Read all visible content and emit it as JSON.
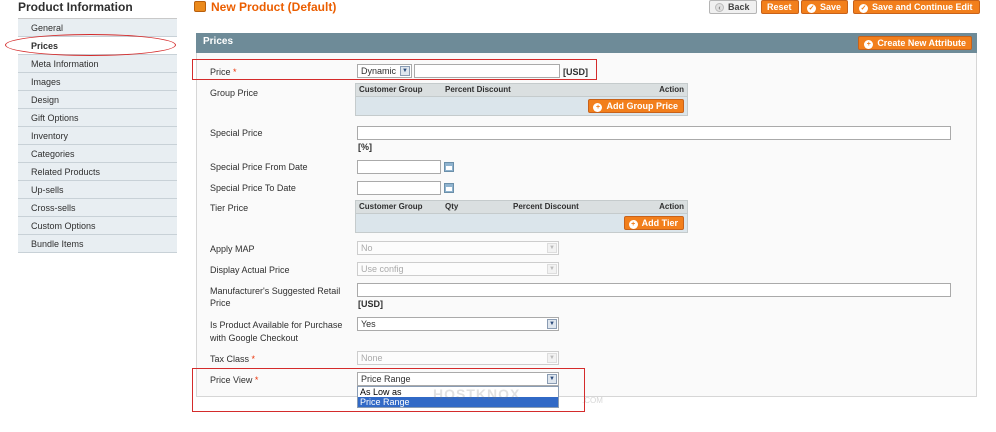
{
  "sidebar": {
    "title": "Product Information",
    "items": [
      "General",
      "Prices",
      "Meta Information",
      "Images",
      "Design",
      "Gift Options",
      "Inventory",
      "Categories",
      "Related Products",
      "Up-sells",
      "Cross-sells",
      "Custom Options",
      "Bundle Items"
    ],
    "active": "Prices"
  },
  "header": {
    "title": "New Product (Default)",
    "back_label": "Back",
    "reset_label": "Reset",
    "save_label": "Save",
    "save_continue_label": "Save and Continue Edit"
  },
  "section": {
    "title": "Prices",
    "create_attribute_label": "Create New Attribute"
  },
  "form": {
    "price": {
      "label": "Price",
      "required": "*",
      "type_value": "Dynamic",
      "value": "",
      "currency": "[USD]"
    },
    "group_price": {
      "label": "Group Price",
      "columns": [
        "Customer Group",
        "Percent Discount",
        "Action"
      ],
      "add_label": "Add Group Price"
    },
    "special_price": {
      "label": "Special Price",
      "value": "",
      "unit": "[%]"
    },
    "special_from": {
      "label": "Special Price From Date",
      "value": ""
    },
    "special_to": {
      "label": "Special Price To Date",
      "value": ""
    },
    "tier_price": {
      "label": "Tier Price",
      "columns": [
        "Customer Group",
        "Qty",
        "Percent Discount",
        "Action"
      ],
      "add_label": "Add Tier"
    },
    "apply_map": {
      "label": "Apply MAP",
      "value": "No"
    },
    "display_actual_price": {
      "label": "Display Actual Price",
      "value": "Use config"
    },
    "msrp": {
      "label_line1": "Manufacturer's Suggested Retail",
      "label_line2": "Price",
      "value": "",
      "currency": "[USD]"
    },
    "google_checkout": {
      "label_line1": "Is Product Available for Purchase",
      "label_line2": "with Google Checkout",
      "value": "Yes"
    },
    "tax_class": {
      "label": "Tax Class",
      "required": "*",
      "value": "None"
    },
    "price_view": {
      "label": "Price View",
      "required": "*",
      "value": "Price Range",
      "options": [
        "As Low as",
        "Price Range"
      ],
      "highlighted": "Price Range"
    }
  },
  "watermark": {
    "text": "HOSTKNOX",
    "suffix": ".COM"
  },
  "colors": {
    "accent": "#f27f1c",
    "section_bar": "#6e8b98",
    "highlight": "#d42b2b",
    "title": "#eb5e00"
  }
}
